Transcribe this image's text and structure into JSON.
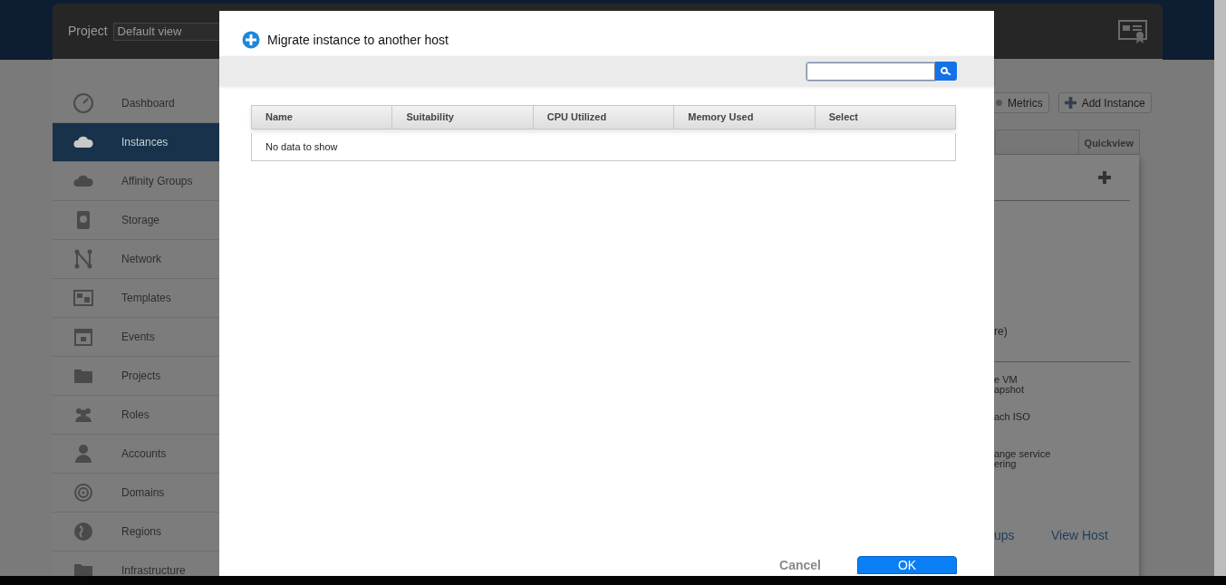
{
  "header": {
    "project_label": "Project",
    "project_value": "Default view"
  },
  "sidebar": {
    "items": [
      {
        "label": "Dashboard",
        "selected": false
      },
      {
        "label": "Instances",
        "selected": true
      },
      {
        "label": "Affinity Groups",
        "selected": false
      },
      {
        "label": "Storage",
        "selected": false
      },
      {
        "label": "Network",
        "selected": false
      },
      {
        "label": "Templates",
        "selected": false
      },
      {
        "label": "Events",
        "selected": false
      },
      {
        "label": "Projects",
        "selected": false
      },
      {
        "label": "Roles",
        "selected": false
      },
      {
        "label": "Accounts",
        "selected": false
      },
      {
        "label": "Domains",
        "selected": false
      },
      {
        "label": "Regions",
        "selected": false
      },
      {
        "label": "Infrastructure",
        "selected": false
      }
    ]
  },
  "background_toolbar": {
    "buttons": [
      "Metrics",
      "Add Instance"
    ]
  },
  "background_table": {
    "column_header": "Quickview"
  },
  "background_panel": {
    "texts": [
      "re)",
      "e VM\napshot",
      "ach ISO",
      "ange service\nering"
    ],
    "links": [
      "ups",
      "View Host"
    ]
  },
  "dialog": {
    "title": "Migrate instance to another host",
    "table": {
      "columns": [
        "Name",
        "Suitability",
        "CPU Utilized",
        "Memory Used",
        "Select"
      ],
      "empty_message": "No data to show"
    },
    "buttons": [
      "Cancel",
      "OK"
    ]
  }
}
